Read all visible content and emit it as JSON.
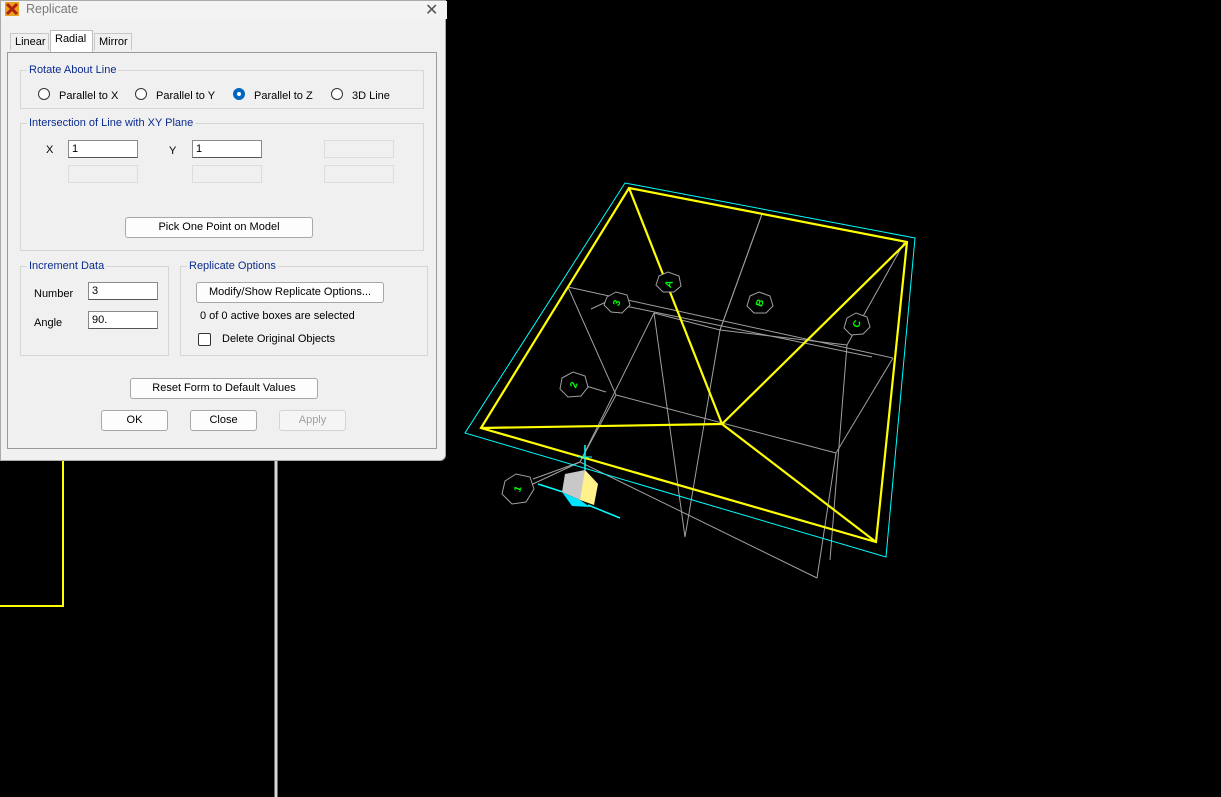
{
  "window": {
    "title": "Replicate",
    "close_glyph": "✕"
  },
  "tabs": [
    {
      "label": "Linear",
      "active": false
    },
    {
      "label": "Radial",
      "active": true
    },
    {
      "label": "Mirror",
      "active": false
    }
  ],
  "rotate_about_line": {
    "title": "Rotate About Line",
    "options": [
      "Parallel to X",
      "Parallel to Y",
      "Parallel to Z",
      "3D Line"
    ],
    "selected": "Parallel to Z"
  },
  "intersection": {
    "title": "Intersection of Line with XY Plane",
    "x_label": "X",
    "x_value": "1",
    "y_label": "Y",
    "y_value": "1",
    "pick_button": "Pick One Point on Model"
  },
  "increment": {
    "title": "Increment Data",
    "number_label": "Number",
    "number_value": "3",
    "angle_label": "Angle",
    "angle_value": "90."
  },
  "replicate_options": {
    "title": "Replicate Options",
    "modify_button": "Modify/Show Replicate Options...",
    "status": "0 of 0 active boxes are selected",
    "delete_label": "Delete Original Objects",
    "delete_checked": false
  },
  "footer": {
    "reset_button": "Reset Form to Default Values",
    "ok_button": "OK",
    "close_button": "Close",
    "apply_button": "Apply"
  },
  "model": {
    "grid_bubbles": [
      "1",
      "2",
      "3",
      "A",
      "B",
      "C"
    ],
    "colors": {
      "frame": "#ffff00",
      "grid": "#a0a0a0",
      "outline": "#00ffff",
      "bubble": "#00ff00",
      "background": "#000000"
    }
  }
}
